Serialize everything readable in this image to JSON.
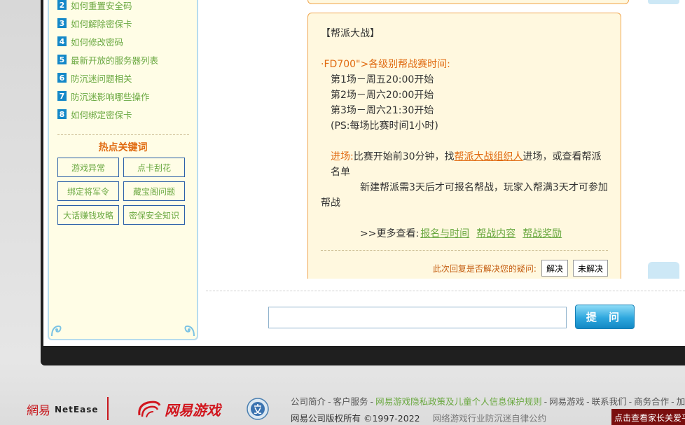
{
  "sidebar": {
    "faq_items": [
      {
        "num": "2",
        "label": "如何重置安全码"
      },
      {
        "num": "3",
        "label": "如何解除密保卡"
      },
      {
        "num": "4",
        "label": "如何修改密码"
      },
      {
        "num": "5",
        "label": "最新开放的服务器列表"
      },
      {
        "num": "6",
        "label": "防沉迷问题相关"
      },
      {
        "num": "7",
        "label": "防沉迷影响哪些操作"
      },
      {
        "num": "8",
        "label": "如何绑定密保卡"
      }
    ],
    "hot_title": "热点关键词",
    "keywords": [
      "游戏异常",
      "点卡刮花",
      "绑定将军令",
      "藏宝阁问题",
      "大话赚钱攻略",
      "密保安全知识"
    ]
  },
  "answer": {
    "heading": "【帮派大战】",
    "schedule_title": "·FD700\">各级别帮战赛时间:",
    "rounds": [
      "第1场－周五20:00开始",
      "第2场－周六20:00开始",
      "第3场－周六21:30开始",
      "(PS:每场比赛时间1小时)"
    ],
    "entry_label": "进场:",
    "entry_text_before": "比赛开始前30分钟，找",
    "entry_link": "帮派大战组织人",
    "entry_text_after": "进场，或查看帮派名单",
    "rule_text": "新建帮派需3天后才可报名帮战，玩家入帮满3天才可参加帮战",
    "more_label": ">>更多查看:",
    "more_links": [
      "报名与时间",
      "帮战内容",
      "帮战奖励"
    ],
    "resolve_question": "此次回复是否解决您的疑问:",
    "resolved_label": "解决",
    "unresolved_label": "未解决"
  },
  "ask": {
    "input_value": "",
    "button_label": "提 问"
  },
  "footer": {
    "logo_netease_cn": "網易",
    "logo_netease_en": "NetEase",
    "logo_games": "网易游戏",
    "links": [
      {
        "label": "公司简介",
        "highlight": false
      },
      {
        "label": "客户服务",
        "highlight": false
      },
      {
        "label": "网易游戏隐私政策及儿童个人信息保护规则",
        "highlight": true
      },
      {
        "label": "网易游戏",
        "highlight": false
      },
      {
        "label": "联系我们",
        "highlight": false
      },
      {
        "label": "商务合作",
        "highlight": false
      },
      {
        "label": "加",
        "highlight": false
      }
    ],
    "copyright": "网易公司版权所有 ©1997-2022",
    "rule": "网络游戏行业防沉迷自律公约",
    "parent_tip": "点击查看家长关爱平台"
  },
  "colors": {
    "accent_green": "#6aa840",
    "accent_orange": "#e06a10",
    "brand_red": "#c7171d",
    "button_blue": "#2ea7de"
  }
}
